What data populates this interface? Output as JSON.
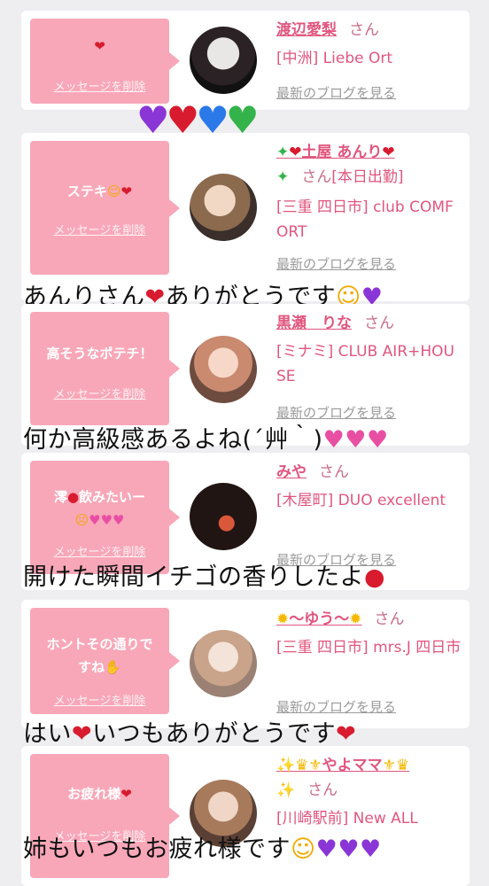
{
  "delete_label": "メッセージを削除",
  "blog_label": "最新のブログを見る",
  "san": "さん",
  "cards": [
    {
      "message": "❤️",
      "name": "渡辺愛梨",
      "shop": "[中洲] Liebe Ort",
      "caption": ""
    },
    {
      "message": "ステキ🥰❤️",
      "name": "✨❤️土屋 あんり❤️✨",
      "status": "[本日出勤]",
      "shop": "[三重 四日市] club COMFORT",
      "caption": "あんりさん❤️ありがとうです☺️💜"
    },
    {
      "message": "高そうなポテチ！",
      "name": "黒瀬　りな",
      "shop": "[ミナミ] CLUB AIR+HOUSE",
      "caption": "何か高級感あるよね(´艸｀)💕💕💕"
    },
    {
      "message": "澪🍓飲みたいー🥺💗💗💗",
      "name": "みや",
      "shop": "[木屋町] DUO excellent",
      "caption": "開けた瞬間イチゴの香りしたよ🍓"
    },
    {
      "message": "ホントその通りですね✋",
      "name": "🌻〜ゆう〜🌻",
      "shop": "[三重 四日市] mrs.J 四日市",
      "caption": "はい❤️いつもありがとうです❤️"
    },
    {
      "message": "お疲れ様❤️",
      "name": "✨👑🔱やよママ🔱👑✨",
      "shop": "[川崎駅前] New ALL",
      "caption": "姉もいつもお疲れ様です☺️💜💜💜"
    }
  ],
  "hearts_row": "💜❤️💙💚",
  "colors": {
    "background": "#eeedf0",
    "bubble": "#f8a7b8",
    "name": "#e0567e",
    "blog": "#9a9a9a"
  }
}
